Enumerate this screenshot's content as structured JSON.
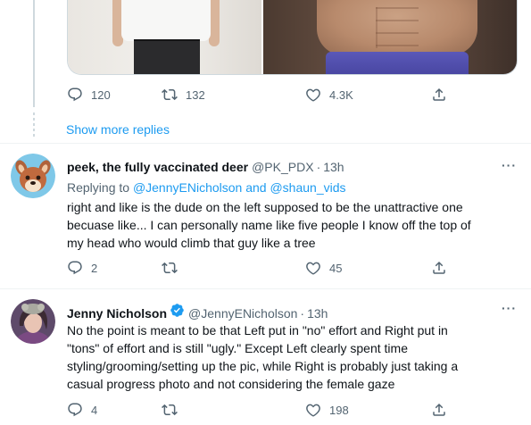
{
  "top_tweet": {
    "actions": {
      "reply_count": "120",
      "retweet_count": "132",
      "like_count": "4.3K"
    }
  },
  "show_more_replies": "Show more replies",
  "reply1": {
    "name": "peek, the fully vaccinated deer",
    "handle": "@PK_PDX",
    "separator": "·",
    "time": "13h",
    "replying_prefix": "Replying to",
    "replying_user1": "@JennyENicholson",
    "replying_and": "and",
    "replying_user2": "@shaun_vids",
    "lines": [
      "right and like is the dude on the left supposed to be the unattractive one",
      "becuase like... I can personally name like five people I know off the top of",
      "my head who would climb that guy like a tree"
    ],
    "actions": {
      "reply_count": "2",
      "retweet_count": "",
      "like_count": "45"
    },
    "more": "···"
  },
  "reply2": {
    "name": "Jenny Nicholson",
    "verified": true,
    "handle": "@JennyENicholson",
    "separator": "·",
    "time": "13h",
    "lines": [
      "No the point is meant to be that Left put in \"no\" effort and Right put in",
      "\"tons\" of effort and is still \"ugly.\" Except Left clearly spent time",
      "styling/grooming/setting up the pic, while Right is probably just taking a",
      "casual progress photo and not considering the female gaze"
    ],
    "actions": {
      "reply_count": "4",
      "retweet_count": "",
      "like_count": "198"
    },
    "more": "···"
  },
  "colors": {
    "link": "#1d9bf0",
    "secondary": "#536471",
    "text": "#0f1419",
    "divider": "#eff3f4"
  },
  "icons": [
    "reply-icon",
    "retweet-icon",
    "like-icon",
    "share-icon",
    "more-icon",
    "verified-badge-icon"
  ]
}
